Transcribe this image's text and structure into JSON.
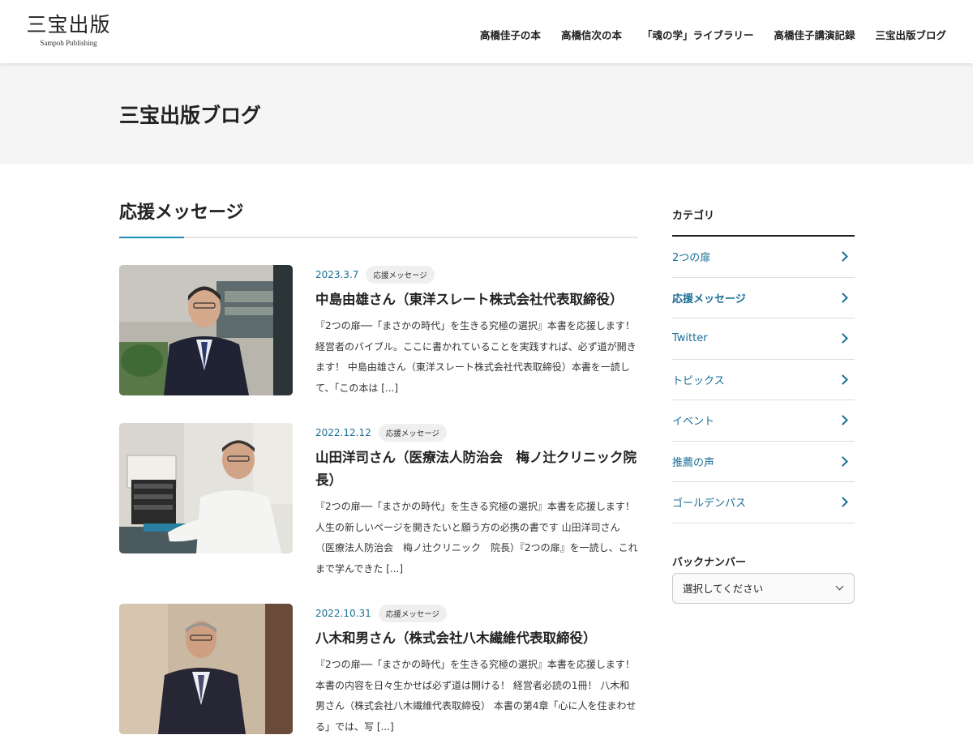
{
  "header": {
    "logo_main": "三宝出版",
    "logo_sub": "Sampoh Publishing",
    "nav": [
      {
        "label": "高橋佳子の本"
      },
      {
        "label": "高橋信次の本"
      },
      {
        "label": "「魂の学」ライブラリー"
      },
      {
        "label": "高橋佳子講演記録"
      },
      {
        "label": "三宝出版ブログ"
      }
    ]
  },
  "page_title": "三宝出版ブログ",
  "section_title": "応援メッセージ",
  "posts": [
    {
      "date": "2023.3.7",
      "tag": "応援メッセージ",
      "title": "中島由雄さん（東洋スレート株式会社代表取締役）",
      "excerpt": "『2つの扉──「まさかの時代」を生きる究極の選択』本書を応援します！ 経営者のバイブル。ここに書かれていることを実践すれば、必ず道が開きます！ 中島由雄さん（東洋スレート株式会社代表取締役）本書を一読して、「この本は [...]"
    },
    {
      "date": "2022.12.12",
      "tag": "応援メッセージ",
      "title": "山田洋司さん（医療法人防治会　梅ノ辻クリニック院長）",
      "excerpt": "『2つの扉──「まさかの時代」を生きる究極の選択』本書を応援します！ 人生の新しいページを開きたいと願う方の必携の書です 山田洋司さん（医療法人防治会　梅ノ辻クリニック　院長）『2つの扉』を一読し、これまで学んできた [...]"
    },
    {
      "date": "2022.10.31",
      "tag": "応援メッセージ",
      "title": "八木和男さん（株式会社八木繊維代表取締役）",
      "excerpt": "『2つの扉──「まさかの時代」を生きる究極の選択』本書を応援します！ 本書の内容を日々生かせば必ず道は開ける！ 経営者必読の1冊！ 八木和男さん（株式会社八木繊維代表取締役） 本書の第4章「心に人を住まわせる」では、写 [...]"
    }
  ],
  "sidebar": {
    "category_heading": "カテゴリ",
    "categories": [
      {
        "label": "2つの扉"
      },
      {
        "label": "応援メッセージ"
      },
      {
        "label": "Twitter"
      },
      {
        "label": "トピックス"
      },
      {
        "label": "イベント"
      },
      {
        "label": "推薦の声"
      },
      {
        "label": "ゴールデンパス"
      }
    ],
    "active_category": "応援メッセージ",
    "backnumber_heading": "バックナンバー",
    "backnumber_select": "選択してください"
  },
  "colors": {
    "accent": "#1a8fb0",
    "link": "#1a6f96",
    "title_band": "#f5f5f5"
  }
}
